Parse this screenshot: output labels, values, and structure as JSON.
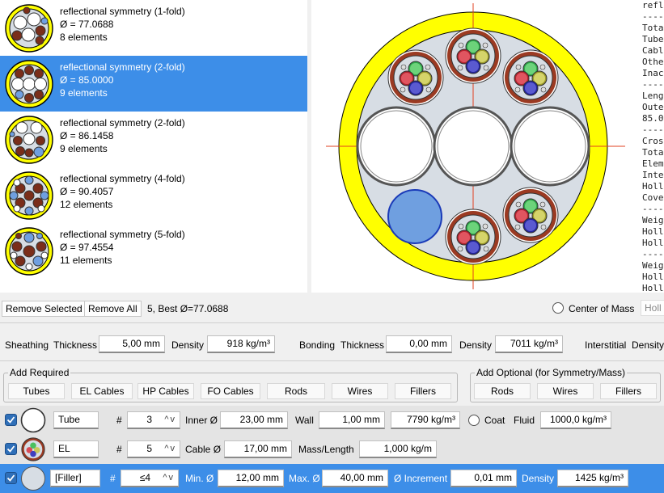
{
  "results": [
    {
      "name": "reflectional symmetry (1-fold)",
      "diameter": "Ø = 77.0688",
      "elements": "8 elements",
      "selected": false
    },
    {
      "name": "reflectional symmetry (2-fold)",
      "diameter": "Ø = 85.0000",
      "elements": "9 elements",
      "selected": true
    },
    {
      "name": "reflectional symmetry (2-fold)",
      "diameter": "Ø = 86.1458",
      "elements": "9 elements",
      "selected": false
    },
    {
      "name": "reflectional symmetry (4-fold)",
      "diameter": "Ø = 90.4057",
      "elements": "12 elements",
      "selected": false
    },
    {
      "name": "reflectional symmetry (5-fold)",
      "diameter": "Ø = 97.4554",
      "elements": "11 elements",
      "selected": false
    }
  ],
  "report_lines": [
    "refl",
    "----",
    "Tota",
    "Tube",
    "Cabl",
    "Othe",
    "Inac",
    "----",
    "Leng",
    "Oute",
    "85.0",
    "----",
    "Cros",
    "Tota",
    "Elem",
    "Inte",
    "Holl",
    "Cove",
    "----",
    "Weig",
    "Holl",
    "Holl",
    "----",
    "Weig",
    "Holl",
    "Holl"
  ],
  "toolbar": {
    "remove_selected": "Remove Selected",
    "remove_all": "Remove All",
    "status": "5, Best Ø=77.0688",
    "center_of_mass": "Center of Mass",
    "hollow": "Holl"
  },
  "sheathing": {
    "label": "Sheathing",
    "thickness_label": "Thickness",
    "thickness": "5,00 mm",
    "density_label": "Density",
    "density": "918 kg/m³"
  },
  "bonding": {
    "label": "Bonding",
    "thickness_label": "Thickness",
    "thickness": "0,00 mm",
    "density_label": "Density",
    "density": "7011 kg/m³"
  },
  "interstitial": {
    "label": "Interstitial",
    "density_label": "Density"
  },
  "add_required": {
    "title": "Add Required",
    "buttons": [
      "Tubes",
      "EL Cables",
      "HP Cables",
      "FO Cables",
      "Rods",
      "Wires",
      "Fillers"
    ]
  },
  "add_optional": {
    "title": "Add Optional (for Symmetry/Mass)",
    "buttons": [
      "Rods",
      "Wires",
      "Fillers"
    ]
  },
  "elements": [
    {
      "name": "Tube",
      "hash": "#",
      "count": "3",
      "dim_label": "Inner Ø",
      "dim": "23,00 mm",
      "wall_label": "Wall",
      "wall": "1,00 mm",
      "density": "7790 kg/m³",
      "coat_label": "Coat",
      "fluid_label": "Fluid",
      "fluid": "1000,0 kg/m³"
    },
    {
      "name": "EL",
      "hash": "#",
      "count": "5",
      "dim_label": "Cable Ø",
      "dim": "17,00 mm",
      "ml_label": "Mass/Length",
      "ml": "1,000 kg/m"
    },
    {
      "name": "[Filler]",
      "hash": "#",
      "count": "≤4",
      "min_label": "Min. Ø",
      "min": "12,00 mm",
      "max_label": "Max. Ø",
      "max": "40,00 mm",
      "inc_label": "Ø Increment",
      "inc": "0,01 mm",
      "density_label": "Density",
      "density": "1425 kg/m³"
    }
  ],
  "colors": {
    "selection": "#3d8ee8",
    "sheath": "#ffff00",
    "filler": "#6f9fe0",
    "cable_jacket": "#9b3a22"
  }
}
